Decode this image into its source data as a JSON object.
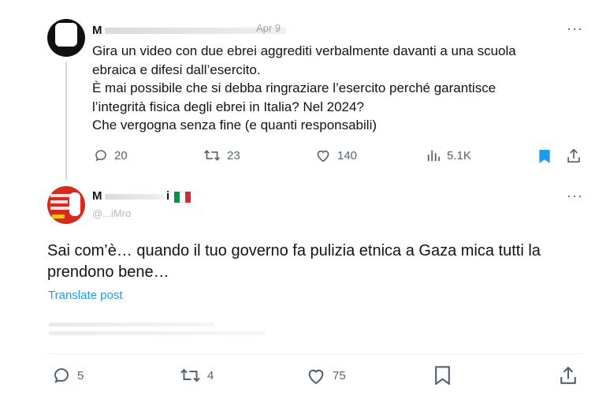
{
  "tweet1": {
    "name_partial": "M",
    "date_partial": "Apr 9",
    "lines": [
      "Gira un video con due ebrei aggrediti verbalmente davanti a una scuola",
      "ebraica e difesi dall’esercito.",
      "È mai possibile che si debba ringraziare l’esercito perché garantisce",
      "l’integrità fisica degli ebrei in Italia? Nel 2024?",
      "Che vergogna senza fine (e quanti responsabili)"
    ],
    "replies": "20",
    "reposts": "23",
    "likes": "140",
    "views": "5.1K",
    "more": "···"
  },
  "tweet2": {
    "name_partial": "M",
    "name_tail": "i",
    "flag": "🇮🇹",
    "handle_partial": "@...iMro",
    "text_lines": [
      "Sai com’è… quando il tuo governo fa pulizia etnica a Gaza mica tutti la",
      "prendono bene…"
    ],
    "translate": "Translate post",
    "replies": "5",
    "reposts": "4",
    "likes": "75",
    "more": "···"
  },
  "colors": {
    "text": "#0f1419",
    "muted": "#536471",
    "link": "#1d9bf0",
    "bookmark_active": "#1d9bf0",
    "thread_line": "#cfd9de",
    "divider": "#eff3f4",
    "avatar2_red": "#d52b1e"
  },
  "icons": [
    "reply-icon",
    "repost-icon",
    "like-icon",
    "views-icon",
    "bookmark-icon",
    "share-icon",
    "more-icon",
    "flag-italy-icon"
  ]
}
